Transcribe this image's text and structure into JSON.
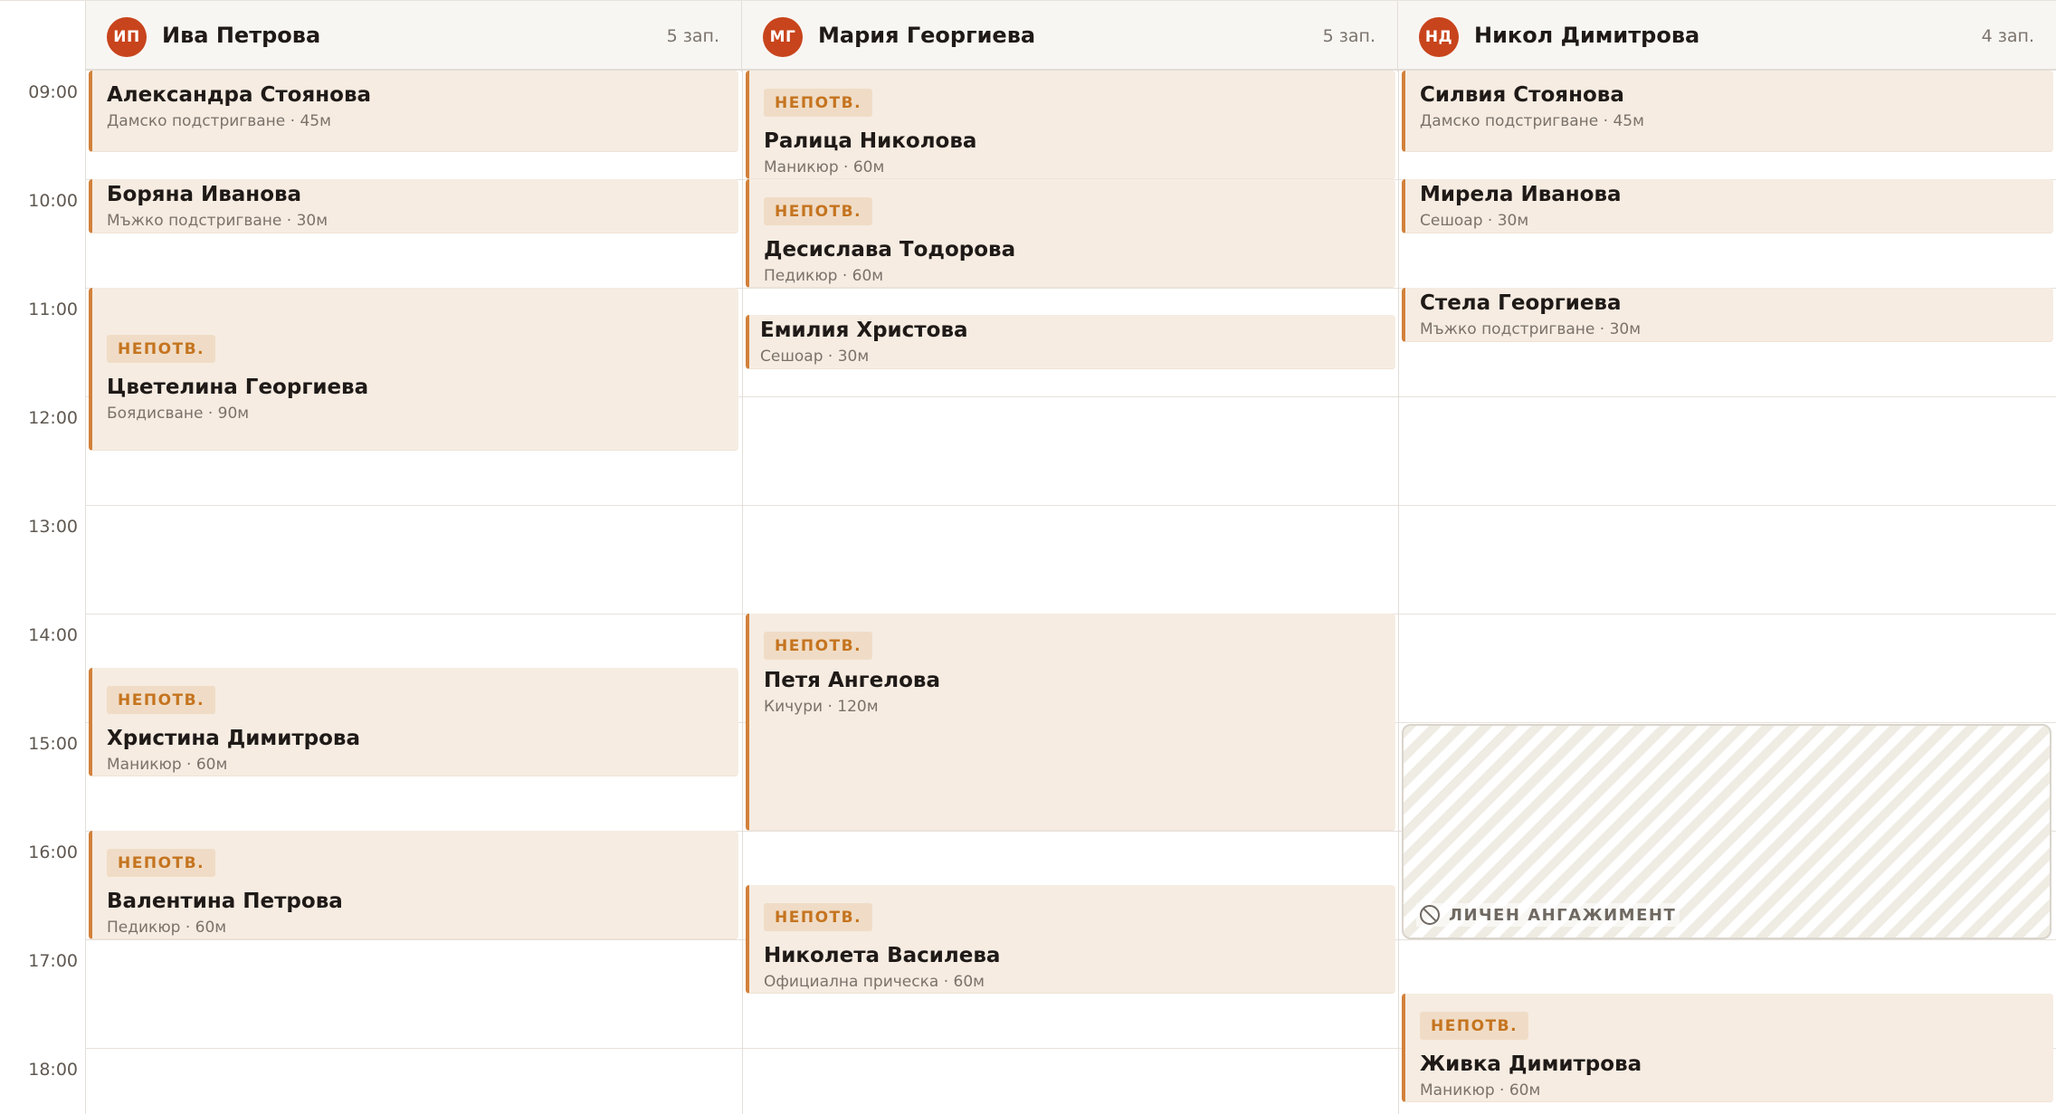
{
  "staff": [
    {
      "initials": "ИП",
      "name": "Ива Петрова",
      "count": "5 зап."
    },
    {
      "initials": "МГ",
      "name": "Мария Георгиева",
      "count": "5 зап."
    },
    {
      "initials": "НД",
      "name": "Никол Димитрова",
      "count": "4 зап."
    }
  ],
  "hours": [
    "09:00",
    "10:00",
    "11:00",
    "12:00",
    "13:00",
    "14:00",
    "15:00",
    "16:00",
    "17:00",
    "18:00"
  ],
  "unconfirmed_label": "НЕПОТВ.",
  "appointments": [
    {
      "staff": 0,
      "client": "Александра Стоянова",
      "service": "Дамско подстригване · 45м",
      "unconfirmed": false
    },
    {
      "staff": 0,
      "client": "Боряна Иванова",
      "service": "Мъжко подстригване · 30м",
      "unconfirmed": false
    },
    {
      "staff": 0,
      "client": "Цветелина Георгиева",
      "service": "Боядисване · 90м",
      "unconfirmed": true
    },
    {
      "staff": 0,
      "client": "Христина Димитрова",
      "service": "Маникюр · 60м",
      "unconfirmed": true
    },
    {
      "staff": 0,
      "client": "Валентина Петрова",
      "service": "Педикюр · 60м",
      "unconfirmed": true
    },
    {
      "staff": 1,
      "client": "Ралица Николова",
      "service": "Маникюр · 60м",
      "unconfirmed": true
    },
    {
      "staff": 1,
      "client": "Десислава Тодорова",
      "service": "Педикюр · 60м",
      "unconfirmed": true
    },
    {
      "staff": 1,
      "client": "Емилия Христова",
      "service": "Сешоар · 30м",
      "unconfirmed": false
    },
    {
      "staff": 1,
      "client": "Петя Ангелова",
      "service": "Кичури · 120м",
      "unconfirmed": true
    },
    {
      "staff": 1,
      "client": "Николета Василева",
      "service": "Официална прическа · 60м",
      "unconfirmed": true
    },
    {
      "staff": 2,
      "client": "Силвия Стоянова",
      "service": "Дамско подстригване · 45м",
      "unconfirmed": false
    },
    {
      "staff": 2,
      "client": "Мирела Иванова",
      "service": "Сешоар · 30м",
      "unconfirmed": false
    },
    {
      "staff": 2,
      "client": "Стела Георгиева",
      "service": "Мъжко подстригване · 30м",
      "unconfirmed": false
    },
    {
      "staff": 2,
      "client": "Живка Димитрова",
      "service": "Маникюр · 60м",
      "unconfirmed": true
    }
  ],
  "blocked": {
    "staff": 2,
    "label": "ЛИЧЕН АНГАЖИМЕНТ"
  },
  "colors": {
    "avatar": "#c8441c",
    "appointment_bg": "#f6ece2",
    "appointment_accent": "#d2813a",
    "badge_text": "#c5741f"
  }
}
